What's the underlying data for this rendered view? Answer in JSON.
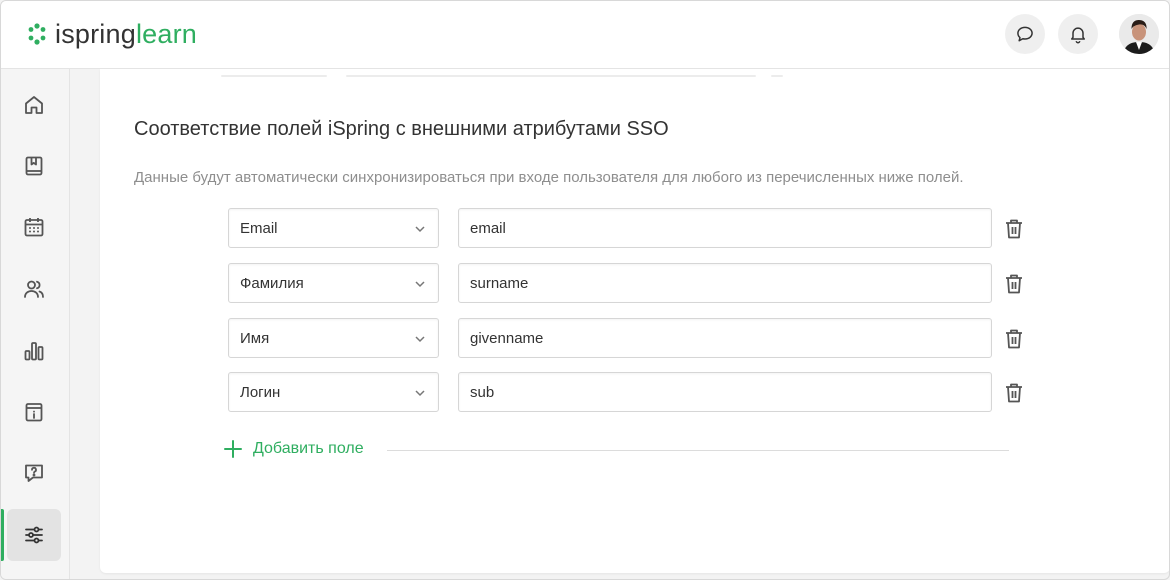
{
  "header": {
    "logo": {
      "part1": "ispring",
      "part2": "learn"
    },
    "buttons": [
      {
        "icon": "chat-icon"
      },
      {
        "icon": "bell-icon"
      }
    ],
    "avatar": {
      "icon": "user-avatar"
    }
  },
  "sidebar": {
    "items": [
      {
        "icon": "home-icon",
        "active": false
      },
      {
        "icon": "book-icon",
        "active": false
      },
      {
        "icon": "calendar-icon",
        "active": false
      },
      {
        "icon": "users-icon",
        "active": false
      },
      {
        "icon": "bar-chart-icon",
        "active": false
      },
      {
        "icon": "info-icon",
        "active": false
      },
      {
        "icon": "question-icon",
        "active": false
      },
      {
        "icon": "sliders-icon",
        "active": true
      }
    ],
    "accent": "#2fae60"
  },
  "main": {
    "title": "Соответствие полей iSpring с внешними атрибутами SSO",
    "subtitle": "Данные будут автоматически синхронизироваться при входе пользователя для любого из перечисленных ниже полей.",
    "mappings": [
      {
        "field": "Email",
        "attribute": "email"
      },
      {
        "field": "Фамилия",
        "attribute": "surname"
      },
      {
        "field": "Имя",
        "attribute": "givenname"
      },
      {
        "field": "Логин",
        "attribute": "sub"
      }
    ],
    "add_label": "Добавить поле"
  }
}
